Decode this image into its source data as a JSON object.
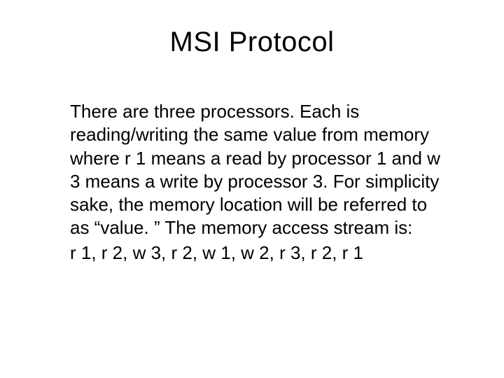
{
  "slide": {
    "title": "MSI Protocol",
    "body": "There are three processors. Each is reading/writing the same value from memory where r 1 means a read by processor 1 and w 3 means a write by processor 3. For simplicity sake, the memory location will be referred to as “value. ” The memory access stream is:",
    "stream": "r 1, r 2, w 3, r 2, w 1, w 2, r 3, r 2, r 1"
  }
}
